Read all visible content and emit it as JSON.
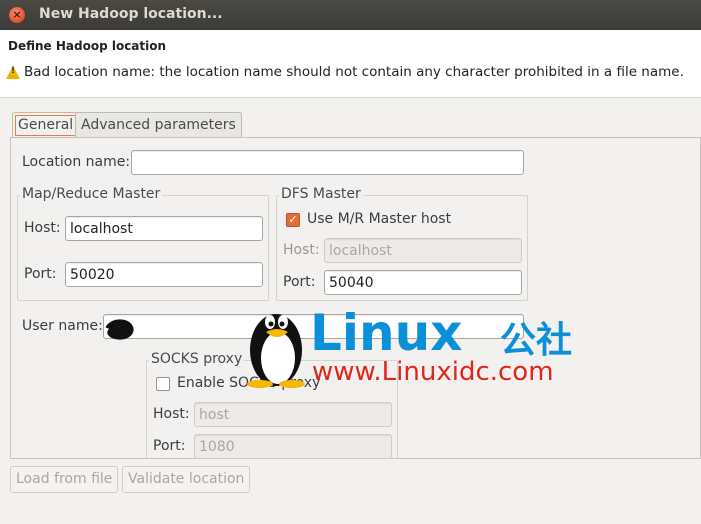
{
  "window": {
    "title": "New Hadoop location..."
  },
  "header": {
    "title": "Define Hadoop location",
    "message": "Bad location name: the location name should not contain any character prohibited in a file name."
  },
  "tabs": [
    {
      "label": "General",
      "active": true
    },
    {
      "label": "Advanced parameters",
      "active": false
    }
  ],
  "form": {
    "location_name": {
      "label": "Location name:",
      "value": ""
    },
    "mapreduce": {
      "title": "Map/Reduce Master",
      "host_label": "Host:",
      "host_value": "localhost",
      "port_label": "Port:",
      "port_value": "50020"
    },
    "dfs": {
      "title": "DFS Master",
      "use_mr_label": "Use M/R Master host",
      "use_mr_checked": true,
      "host_label": "Host:",
      "host_value": "localhost",
      "port_label": "Port:",
      "port_value": "50040"
    },
    "user_name": {
      "label": "User name:",
      "value": ""
    },
    "socks": {
      "title": "SOCKS proxy",
      "enable_label": "Enable SOCKS proxy",
      "enable_checked": false,
      "host_label": "Host:",
      "host_value": "host",
      "port_label": "Port:",
      "port_value": "1080"
    }
  },
  "buttons": {
    "load": "Load from file",
    "validate": "Validate location"
  },
  "watermark": {
    "brand": "Linux",
    "cn": "公社",
    "url": "www.Linuxidc.com",
    "color": "#0a8fd8",
    "url_color": "#e0261b"
  },
  "colors": {
    "accent": "#e46f36",
    "titlebar": "#3c3b37"
  }
}
